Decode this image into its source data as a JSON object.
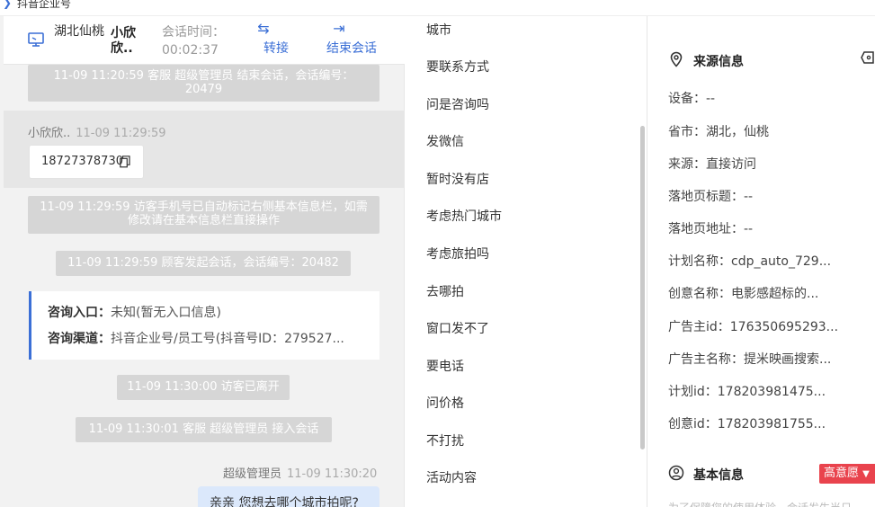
{
  "app": {
    "name": "抖音企业号"
  },
  "header": {
    "location": "湖北仙桃",
    "visitor_name": "小欣欣..",
    "time_label": "会话时间：",
    "time_value": "00:02:37",
    "transfer_label": "转接",
    "end_label": "结束会话"
  },
  "chat": {
    "sys_1": "11-09 11:20:59 客服 超级管理员 结束会话，会话编号：20479",
    "visitor_name": "小欣欣..",
    "visitor_time": "11-09 11:29:59",
    "visitor_phone": "18727378730",
    "sys_2": "11-09 11:29:59 访客手机号已自动标记右侧基本信息栏，如需修改请在基本信息栏直接操作",
    "sys_3": "11-09 11:29:59 顾客发起会话，会话编号：20482",
    "card": {
      "entry_key": "咨询入口：",
      "entry_val": "未知(暂无入口信息)",
      "channel_key": "咨询渠道：",
      "channel_val": "抖音企业号/员工号(抖音号ID：279527..."
    },
    "sys_4": "11-09 11:30:00 访客已离开",
    "sys_5": "11-09 11:30:01 客服 超级管理员 接入会话",
    "agent_name": "超级管理员",
    "agent_time": "11-09 11:30:20",
    "agent_msg": "亲亲 您想去哪个城市拍呢?"
  },
  "phrases": [
    "城市",
    "要联系方式",
    "问是咨询吗",
    "发微信",
    "暂时没有店",
    "考虑热门城市",
    "考虑旅拍吗",
    "去哪拍",
    "窗口发不了",
    "要电话",
    "问价格",
    "不打扰",
    "活动内容"
  ],
  "source": {
    "title": "来源信息",
    "device": "设备：--",
    "province": "省市：湖北，仙桃",
    "origin": "来源：直接访问",
    "landing_title": "落地页标题：--",
    "landing_url": "落地页地址：--",
    "plan_name": "计划名称：cdp_auto_729...",
    "creative_name": "创意名称：电影感超标的...",
    "advertiser_id": "广告主id：176350695293...",
    "advertiser_name": "广告主名称：提米映画搜索...",
    "plan_id": "计划id：178203981475...",
    "creative_id": "创意id：178203981755..."
  },
  "basic": {
    "title": "基本信息",
    "intent_badge": "高意愿",
    "note": "为了保障您的使用体验，会话发生当日"
  },
  "colors": {
    "accent": "#3b6fd6",
    "badge": "#e9434d"
  }
}
